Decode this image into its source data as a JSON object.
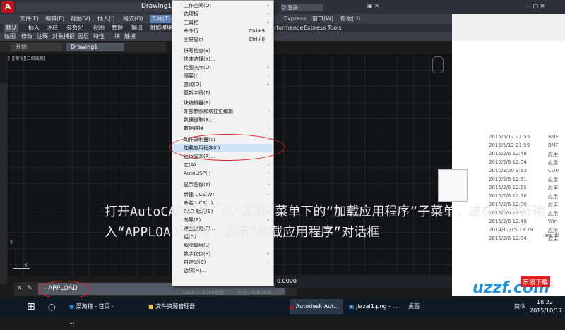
{
  "title_bar": {
    "app_icon_letter": "A",
    "doc_title": "Drawing1.d",
    "login_label": "登录"
  },
  "menu_bar": {
    "items": [
      "文件(F)",
      "编辑(E)",
      "视图(V)",
      "插入(I)",
      "格式(O)",
      "工具(T)",
      "Express",
      "窗口(W)",
      "帮助(H)"
    ]
  },
  "ribbon_tabs": {
    "items": [
      "默认",
      "插入",
      "注释",
      "参数化",
      "视图",
      "管理",
      "输出",
      "附加模块",
      "rformance",
      "Express Tools"
    ]
  },
  "ribbon_row": {
    "items": [
      "绘图",
      "修改",
      "注释",
      "对象捕捉",
      "图层",
      "特性",
      "块",
      "触摸"
    ]
  },
  "doc_tabs": {
    "start": "开始",
    "drawing": "Drawing1"
  },
  "viewport_label": "[-][俯视][二维线框]",
  "command": {
    "value": "- APPLOAD"
  },
  "status": {
    "coord": "0.0000",
    "dim1": "1920 × 1080像素",
    "dim2": "大小: 488.5KB"
  },
  "tools_menu": {
    "items": [
      {
        "label": "工作空间(O)",
        "shortcut": "",
        "arrow": "›"
      },
      {
        "label": "选项板",
        "shortcut": "",
        "arrow": "›"
      },
      {
        "label": "工具栏",
        "shortcut": "",
        "arrow": "›"
      },
      {
        "label": "命令行",
        "shortcut": "Ctrl+9",
        "arrow": ""
      },
      {
        "label": "全屏显示",
        "shortcut": "Ctrl+0",
        "arrow": ""
      },
      {
        "label": "拼写检查(E)",
        "shortcut": "",
        "arrow": ""
      },
      {
        "label": "快速选择(K)...",
        "shortcut": "",
        "arrow": ""
      },
      {
        "label": "绘图次序(D)",
        "shortcut": "",
        "arrow": "›"
      },
      {
        "label": "隔离(I)",
        "shortcut": "",
        "arrow": "›"
      },
      {
        "label": "查询(Q)",
        "shortcut": "",
        "arrow": "›"
      },
      {
        "label": "更新字段(T)",
        "shortcut": "",
        "arrow": ""
      },
      {
        "label": "块编辑器(B)",
        "shortcut": "",
        "arrow": ""
      },
      {
        "label": "外部参照和块在位编辑",
        "shortcut": "",
        "arrow": "›"
      },
      {
        "label": "数据提取(X)...",
        "shortcut": "",
        "arrow": ""
      },
      {
        "label": "数据链接",
        "shortcut": "",
        "arrow": "›"
      },
      {
        "label": "动作录制器(T)",
        "shortcut": "",
        "arrow": "›"
      },
      {
        "label": "加载应用程序(L)...",
        "shortcut": "",
        "arrow": ""
      },
      {
        "label": "运行脚本(R)...",
        "shortcut": "",
        "arrow": ""
      },
      {
        "label": "宏(A)",
        "shortcut": "",
        "arrow": "›"
      },
      {
        "label": "AutoLISP(I)",
        "shortcut": "",
        "arrow": "›"
      },
      {
        "label": "显示图像(Y)",
        "shortcut": "",
        "arrow": "›"
      },
      {
        "label": "新建 UCS(W)",
        "shortcut": "",
        "arrow": "›"
      },
      {
        "label": "命名 UCS(U)...",
        "shortcut": "",
        "arrow": ""
      },
      {
        "label": "CAD 标准(S)",
        "shortcut": "",
        "arrow": "›"
      },
      {
        "label": "向导(Z)",
        "shortcut": "",
        "arrow": "›"
      },
      {
        "label": "绘图设置(F)...",
        "shortcut": "",
        "arrow": ""
      },
      {
        "label": "组(G)",
        "shortcut": "",
        "arrow": ""
      },
      {
        "label": "解除编组(U)",
        "shortcut": "",
        "arrow": ""
      },
      {
        "label": "数字化仪(B)",
        "shortcut": "",
        "arrow": "›"
      },
      {
        "label": "自定义(C)",
        "shortcut": "",
        "arrow": "›"
      },
      {
        "label": "选项(N)...",
        "shortcut": "",
        "arrow": ""
      }
    ]
  },
  "caption": {
    "text": "打开AutoCAD程序，点“工具”菜单下的“加载应用程序”子菜单，或在命令行输入“APPLOAD”命令，显示“加载应用程序”对话框"
  },
  "explorer": {
    "dates": [
      "2015/5/12 21:55",
      "2015/5/12 21:59",
      "2015/2/6 12:48",
      "2015/2/6 12:54",
      "2010/3/20 3:53",
      "2015/2/6 12:31",
      "2015/2/6 12:55",
      "2015/2/6 12:30",
      "2015/2/6 12:30",
      "2015/2/6 12:31",
      "2015/2/6 12:48",
      "2014/12/15 13:19",
      "2015/2/6 12:54"
    ],
    "types": [
      "BMF",
      "BMF",
      "应用",
      "应用",
      "COM",
      "应用",
      "应用",
      "应用",
      "应用",
      "应用",
      "Win",
      "应用",
      "应用"
    ],
    "file_hint": "ew.dll"
  },
  "taskbar": {
    "items": [
      "爱淘特 - 首页 - ...",
      "文件资源管理器",
      "Autodesk Aut...",
      "jiazai1.png - ...",
      "桌面"
    ],
    "ime": "简体",
    "time": "18:22",
    "date": "2015/10/17"
  },
  "brand": {
    "name": "uzzf.com",
    "sub": "东坡下载"
  },
  "colors": {
    "highlight": "#cde3f7",
    "annotation": "#e02020",
    "accent": "#c0131b"
  }
}
